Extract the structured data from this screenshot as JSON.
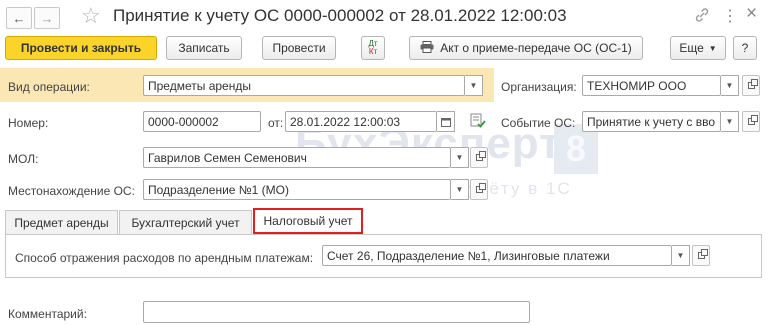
{
  "window": {
    "title": "Принятие к учету ОС 0000-000002 от 28.01.2022 12:00:03",
    "more_label": "⋮",
    "close_label": "×"
  },
  "toolbar": {
    "post_close_label": "Провести и закрыть",
    "save_label": "Записать",
    "post_label": "Провести",
    "dtkt_top": "Дт",
    "dtkt_bottom": "Кт",
    "act_label": "Акт о приеме-передаче ОС (ОС-1)",
    "more_label": "Еще",
    "help_label": "?"
  },
  "form": {
    "operation_type": {
      "label": "Вид операции:",
      "value": "Предметы аренды"
    },
    "organization": {
      "label": "Организация:",
      "value": "ТЕХНОМИР ООО"
    },
    "number": {
      "label": "Номер:",
      "value": "0000-000002"
    },
    "date": {
      "label": "от:",
      "value": "28.01.2022 12:00:03"
    },
    "os_event": {
      "label": "Событие ОС:",
      "value": "Принятие к учету с вво"
    },
    "mol": {
      "label": "МОЛ:",
      "value": "Гаврилов Семен Семенович"
    },
    "location": {
      "label": "Местонахождение ОС:",
      "value": "Подразделение №1 (МО)"
    },
    "comment": {
      "label": "Комментарий:",
      "value": ""
    }
  },
  "tabs": [
    {
      "label": "Предмет аренды"
    },
    {
      "label": "Бухгалтерский учет"
    },
    {
      "label": "Налоговый учет"
    }
  ],
  "tax_tab": {
    "expense_label": "Способ отражения расходов по арендным платежам:",
    "expense_value": "Счет 26, Подразделение №1, Лизинговые платежи"
  },
  "watermark": {
    "brand": "БухЭксперт",
    "digit": "8",
    "subtitle": "База ответов по учёту в 1С"
  },
  "colors": {
    "accent": "#fbd42b",
    "highlight_bg": "#fbe7b4",
    "active_tab_border": "#e02020"
  }
}
